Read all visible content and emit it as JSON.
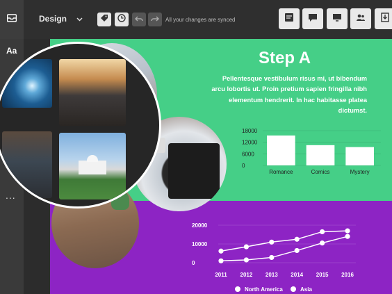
{
  "toolbar": {
    "design_label": "Design",
    "sync_status": "All your changes are synced"
  },
  "sidebar": {
    "text_tool_label": "Aa",
    "more_label": "..."
  },
  "slide": {
    "title": "Step A",
    "body": "Pellentesque vestibulum risus mi, ut bibendum arcu lobortis ut. Proin pretium sapien fringilla nibh elementum hendrerit. In hac habitasse platea dictumst."
  },
  "chart_data": [
    {
      "type": "bar",
      "categories": [
        "Romance",
        "Comics",
        "Mystery"
      ],
      "values": [
        15500,
        10500,
        9500
      ],
      "yticks": [
        "18000",
        "12000",
        "6000",
        "0"
      ],
      "ylim": [
        0,
        18000
      ],
      "color": "#ffffff"
    },
    {
      "type": "line",
      "x": [
        "2011",
        "2012",
        "2013",
        "2014",
        "2015",
        "2016"
      ],
      "yticks": [
        "20000",
        "10000",
        "0"
      ],
      "ylim": [
        0,
        20000
      ],
      "series": [
        {
          "name": "North America",
          "values": [
            6200,
            8500,
            11000,
            12500,
            16500,
            17000
          ]
        },
        {
          "name": "Asia",
          "values": [
            1000,
            1500,
            2800,
            6500,
            10500,
            14000
          ]
        }
      ],
      "color": "#ffffff"
    }
  ]
}
